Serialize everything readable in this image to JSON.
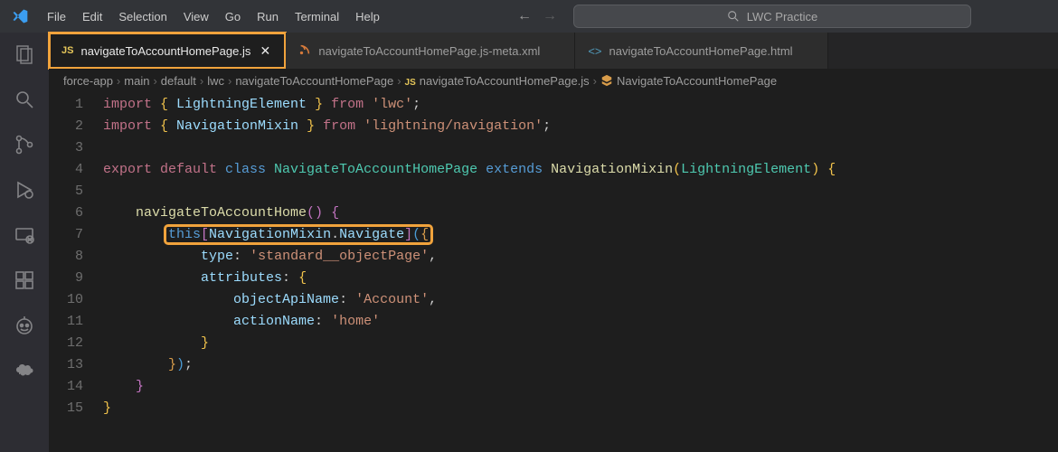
{
  "menu": [
    "File",
    "Edit",
    "Selection",
    "View",
    "Go",
    "Run",
    "Terminal",
    "Help"
  ],
  "search": {
    "placeholder": "LWC Practice"
  },
  "tabs": [
    {
      "icon": "js",
      "label": "navigateToAccountHomePage.js",
      "active": true
    },
    {
      "icon": "xml",
      "label": "navigateToAccountHomePage.js-meta.xml",
      "active": false
    },
    {
      "icon": "html",
      "label": "navigateToAccountHomePage.html",
      "active": false
    }
  ],
  "breadcrumbs": {
    "segments": [
      "force-app",
      "main",
      "default",
      "lwc",
      "navigateToAccountHomePage"
    ],
    "fileIcon": "js",
    "fileName": "navigateToAccountHomePage.js",
    "symbolName": "NavigateToAccountHomePage"
  },
  "linenumbers": [
    "1",
    "2",
    "3",
    "4",
    "5",
    "6",
    "7",
    "8",
    "9",
    "10",
    "11",
    "12",
    "13",
    "14",
    "15"
  ],
  "code": {
    "l1": {
      "import": "import ",
      "ob": "{ ",
      "t": "LightningElement ",
      "cb": "} ",
      "from": "from ",
      "str": "'lwc'",
      "sc": ";"
    },
    "l2": {
      "import": "import ",
      "ob": "{ ",
      "t": "NavigationMixin ",
      "cb": "} ",
      "from": "from ",
      "str": "'lightning/navigation'",
      "sc": ";"
    },
    "l4": {
      "export": "export ",
      "default": "default ",
      "class": "class ",
      "name": "NavigateToAccountHomePage ",
      "extends": "extends ",
      "mixin": "NavigationMixin",
      "op": "(",
      "le": "LightningElement",
      "cp": ") ",
      "ob": "{"
    },
    "l6": {
      "indent": "    ",
      "fn": "navigateToAccountHome",
      "par": "() ",
      "ob": "{"
    },
    "l7": {
      "indent": "        ",
      "this": "this",
      "lb": "[",
      "mix": "NavigationMixin",
      "dot": ".",
      "nav": "Navigate",
      "rb": "]",
      "op": "(",
      "ob": "{"
    },
    "l8": {
      "indent": "            ",
      "prop": "type",
      "col": ": ",
      "str": "'standard__objectPage'",
      "comma": ","
    },
    "l9": {
      "indent": "            ",
      "prop": "attributes",
      "col": ": ",
      "ob": "{"
    },
    "l10": {
      "indent": "                ",
      "prop": "objectApiName",
      "col": ": ",
      "str": "'Account'",
      "comma": ","
    },
    "l11": {
      "indent": "                ",
      "prop": "actionName",
      "col": ": ",
      "str": "'home'"
    },
    "l12": {
      "indent": "            ",
      "cb": "}"
    },
    "l13": {
      "indent": "        ",
      "cb": "}",
      ")": ")",
      ";": ";"
    },
    "l14": {
      "indent": "    ",
      "cb": "}"
    },
    "l15": {
      "cb": "}"
    }
  }
}
